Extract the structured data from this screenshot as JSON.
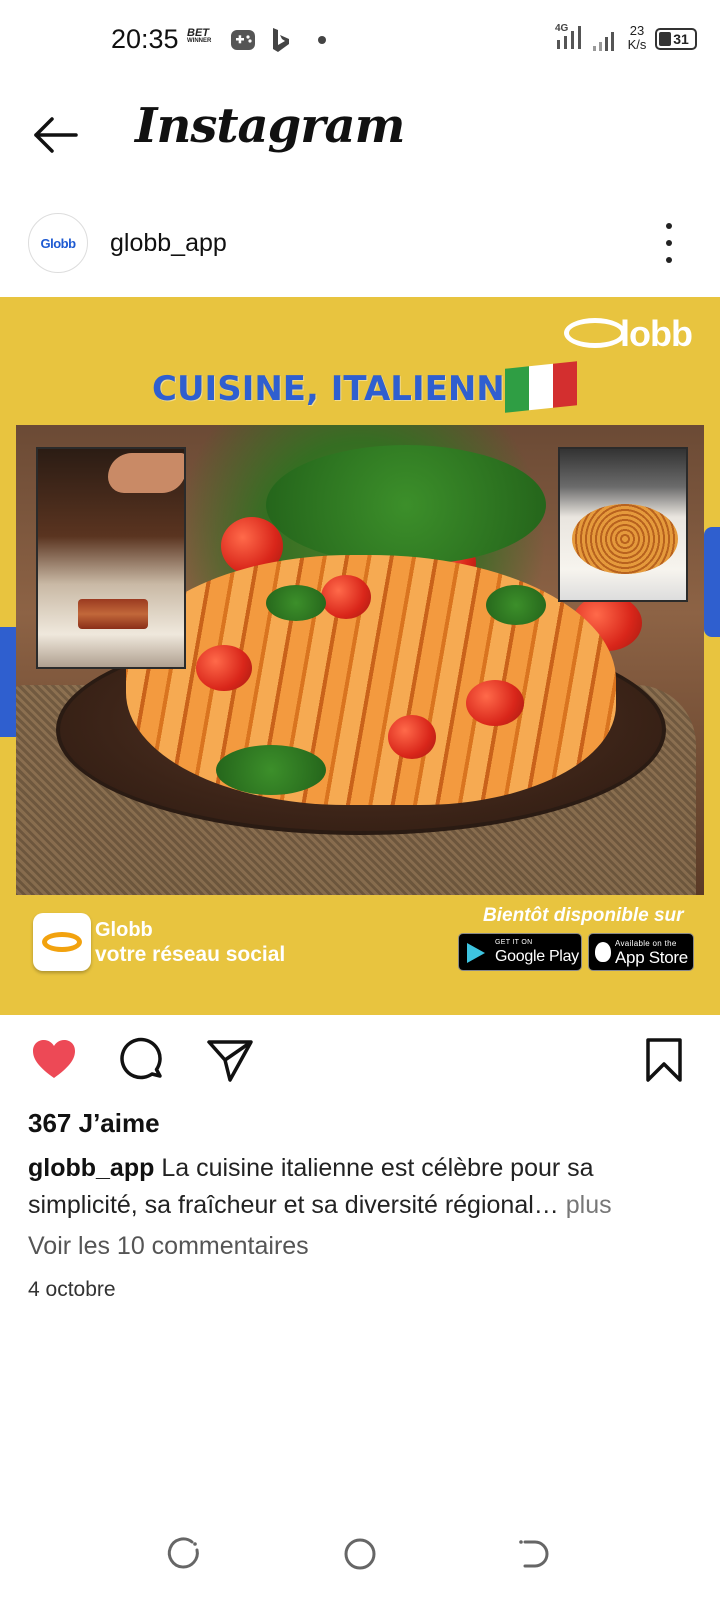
{
  "status_bar": {
    "time": "20:35",
    "betwinner_line1": "BET",
    "betwinner_line2": "WINNER",
    "network": "4G",
    "speed_value": "23",
    "speed_unit": "K/s",
    "battery": "31"
  },
  "header": {
    "title": "Instagram"
  },
  "post": {
    "username": "globb_app",
    "avatar_text": "Globb",
    "image": {
      "brand_logo": "lobb",
      "headline": "CUISINE, ITALIENNE",
      "app_name": "Globb",
      "app_tagline": "votre réseau social",
      "store_caption": "Bientôt disponible sur",
      "google_play_small": "GET IT ON",
      "google_play_big": "Google Play",
      "app_store_small": "Available on the",
      "app_store_big": "App Store",
      "flag_colors": [
        "#2f9e44",
        "#ffffff",
        "#d32f2f"
      ],
      "background_color": "#e8c43f",
      "headline_color": "#2f5fcf"
    },
    "likes": "367 J’aime",
    "caption_user": "globb_app",
    "caption_text": "La cuisine italienne est célèbre pour sa simplicité, sa fraîcheur et sa diversité régional…",
    "caption_more": "plus",
    "comments_link": "Voir les 10 commentaires",
    "date": "4 octobre",
    "liked": true,
    "like_color": "#ed4956"
  },
  "icons": {
    "back": "arrow-left-icon",
    "more": "more-vertical-icon",
    "like": "heart-icon",
    "comment": "comment-icon",
    "share": "send-icon",
    "save": "bookmark-icon",
    "nav_recents": "recents-icon",
    "nav_home": "home-circle-icon",
    "nav_back": "nav-back-icon"
  }
}
